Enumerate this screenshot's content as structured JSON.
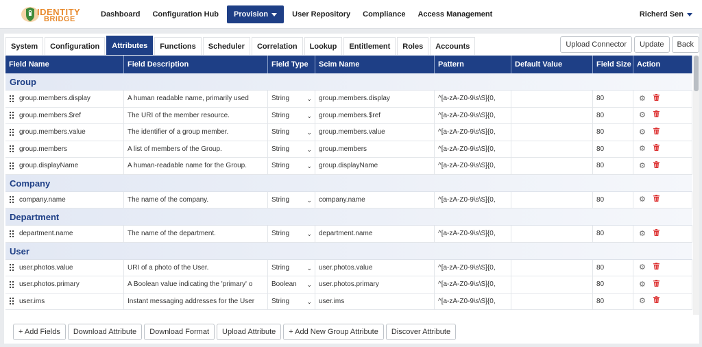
{
  "logo": {
    "line1": "IDENTITY",
    "line2": "BRIDGE"
  },
  "nav": [
    {
      "label": "Dashboard",
      "active": false
    },
    {
      "label": "Configuration Hub",
      "active": false
    },
    {
      "label": "Provision",
      "active": true
    },
    {
      "label": "User Repository",
      "active": false
    },
    {
      "label": "Compliance",
      "active": false
    },
    {
      "label": "Access Management",
      "active": false
    }
  ],
  "user": {
    "name": "Richerd Sen"
  },
  "tabs": [
    "System",
    "Configuration",
    "Attributes",
    "Functions",
    "Scheduler",
    "Correlation",
    "Lookup",
    "Entitlement",
    "Roles",
    "Accounts"
  ],
  "active_tab": "Attributes",
  "top_buttons": [
    "Upload Connector",
    "Update",
    "Back"
  ],
  "columns": [
    "Field Name",
    "Field Description",
    "Field Type",
    "Scim Name",
    "Pattern",
    "Default Value",
    "Field Size",
    "Action"
  ],
  "groups": [
    {
      "name": "Group",
      "rows": [
        {
          "field": "group.members.display",
          "desc": "A human readable name, primarily used",
          "type": "String",
          "scim": "group.members.display",
          "pattern": "^[a-zA-Z0-9\\s\\S]{0,",
          "default": "",
          "size": "80"
        },
        {
          "field": "group.members.$ref",
          "desc": "The URI of the member resource.",
          "type": "String",
          "scim": "group.members.$ref",
          "pattern": "^[a-zA-Z0-9\\s\\S]{0,",
          "default": "",
          "size": "80"
        },
        {
          "field": "group.members.value",
          "desc": "The identifier of a group member.",
          "type": "String",
          "scim": "group.members.value",
          "pattern": "^[a-zA-Z0-9\\s\\S]{0,",
          "default": "",
          "size": "80"
        },
        {
          "field": "group.members",
          "desc": "A list of members of the Group.",
          "type": "String",
          "scim": "group.members",
          "pattern": "^[a-zA-Z0-9\\s\\S]{0,",
          "default": "",
          "size": "80"
        },
        {
          "field": "group.displayName",
          "desc": "A human-readable name for the Group.",
          "type": "String",
          "scim": "group.displayName",
          "pattern": "^[a-zA-Z0-9\\s\\S]{0,",
          "default": "",
          "size": "80"
        }
      ]
    },
    {
      "name": "Company",
      "rows": [
        {
          "field": "company.name",
          "desc": "The name of the company.",
          "type": "String",
          "scim": "company.name",
          "pattern": "^[a-zA-Z0-9\\s\\S]{0,",
          "default": "",
          "size": "80"
        }
      ]
    },
    {
      "name": "Department",
      "rows": [
        {
          "field": "department.name",
          "desc": "The name of the department.",
          "type": "String",
          "scim": "department.name",
          "pattern": "^[a-zA-Z0-9\\s\\S]{0,",
          "default": "",
          "size": "80"
        }
      ]
    },
    {
      "name": "User",
      "rows": [
        {
          "field": "user.photos.value",
          "desc": "URI of a photo of the User.",
          "type": "String",
          "scim": "user.photos.value",
          "pattern": "^[a-zA-Z0-9\\s\\S]{0,",
          "default": "",
          "size": "80"
        },
        {
          "field": "user.photos.primary",
          "desc": "A Boolean value indicating the 'primary' o",
          "type": "Boolean",
          "scim": "user.photos.primary",
          "pattern": "^[a-zA-Z0-9\\s\\S]{0,",
          "default": "",
          "size": "80"
        },
        {
          "field": "user.ims",
          "desc": "Instant messaging addresses for the User",
          "type": "String",
          "scim": "user.ims",
          "pattern": "^[a-zA-Z0-9\\s\\S]{0,",
          "default": "",
          "size": "80"
        }
      ]
    }
  ],
  "bottom_buttons": [
    "+ Add Fields",
    "Download Attribute",
    "Download Format",
    "Upload Attribute",
    "+ Add New Group Attribute",
    "Discover Attribute"
  ],
  "colors": {
    "primary": "#1e3f86",
    "logo_orange": "#e8892b",
    "delete_red": "#dd3333"
  }
}
